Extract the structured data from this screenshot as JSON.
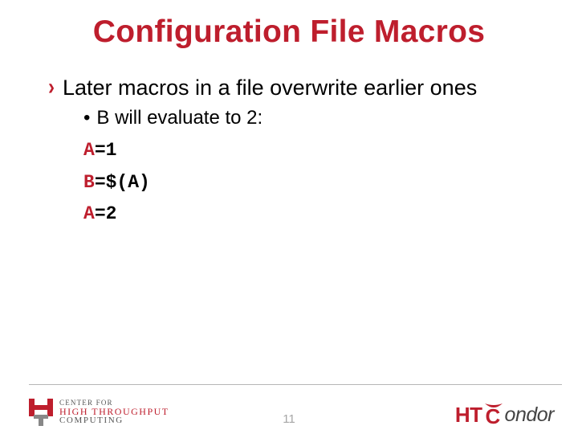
{
  "title": "Configuration File Macros",
  "bullets": {
    "b1": "Later macros in a file overwrite earlier ones",
    "b2": "B will evaluate to 2:"
  },
  "code": {
    "l1": {
      "kw": "A",
      "rest": "=1"
    },
    "l2": {
      "kw": "B",
      "rest": "=$(A)"
    },
    "l3": {
      "kw": "A",
      "rest": "=2"
    }
  },
  "page_number": "11",
  "footer": {
    "left": {
      "l1": "CENTER FOR",
      "l2": "HIGH THROUGHPUT",
      "l3": "COMPUTING"
    },
    "right": {
      "ht": "HT",
      "c": "C",
      "ondor": "ondor"
    }
  }
}
